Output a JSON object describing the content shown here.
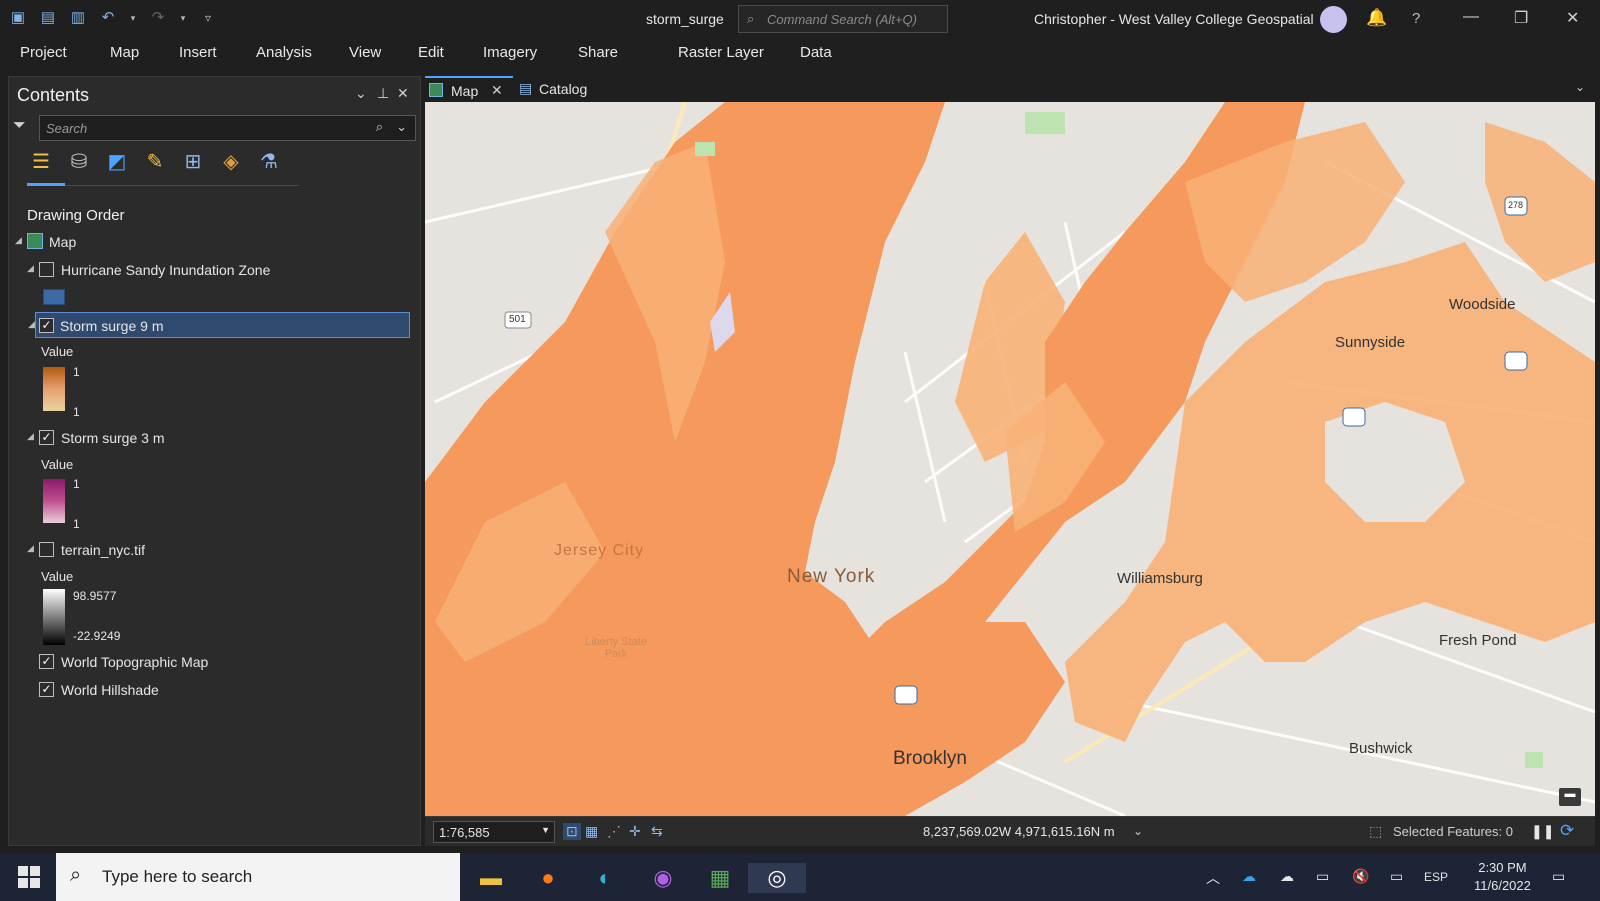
{
  "window": {
    "document_title": "storm_surge",
    "command_search_placeholder": "Command Search (Alt+Q)",
    "user": "Christopher  -  West Valley College Geospatial"
  },
  "menu": [
    "Project",
    "Map",
    "Insert",
    "Analysis",
    "View",
    "Edit",
    "Imagery",
    "Share",
    "Raster Layer",
    "Data"
  ],
  "contents": {
    "title": "Contents",
    "search_placeholder": "Search",
    "section": "Drawing Order",
    "map_node": "Map",
    "layers": [
      {
        "name": "Hurricane Sandy Inundation Zone",
        "checked": false
      },
      {
        "name": "Storm surge 9 m",
        "checked": true,
        "selected": true,
        "legend_title": "Value",
        "max": "1",
        "min": "1"
      },
      {
        "name": "Storm surge 3 m",
        "checked": true,
        "legend_title": "Value",
        "max": "1",
        "min": "1"
      },
      {
        "name": "terrain_nyc.tif",
        "checked": false,
        "legend_title": "Value",
        "max": "98.9577",
        "min": "-22.9249"
      },
      {
        "name": "World Topographic Map",
        "checked": true
      },
      {
        "name": "World Hillshade",
        "checked": true
      }
    ]
  },
  "map_tabs": [
    {
      "label": "Map",
      "icon": "map-icon",
      "active": true
    },
    {
      "label": "Catalog",
      "icon": "catalog-icon",
      "active": false
    }
  ],
  "map_labels": {
    "jersey_city": "Jersey City",
    "new_york": "New York",
    "williamsburg": "Williamsburg",
    "brooklyn": "Brooklyn",
    "sunnyside": "Sunnyside",
    "woodside": "Woodside",
    "fresh_pond": "Fresh Pond",
    "bushwick": "Bushwick",
    "liberty_state_park": "Liberty State Park",
    "route_501": "501",
    "route_278": "278"
  },
  "status": {
    "scale": "1:76,585",
    "coordinates": "8,237,569.02W 4,971,615.16N m",
    "selected_features": "Selected Features: 0"
  },
  "taskbar": {
    "search_placeholder": "Type here to search",
    "language": "ESP",
    "time": "2:30 PM",
    "date": "11/6/2022"
  },
  "colors": {
    "surge_orange": "#f59a5c",
    "surge_light": "#f8b177",
    "accent": "#4da3ff",
    "selection": "#2f4a6e"
  }
}
